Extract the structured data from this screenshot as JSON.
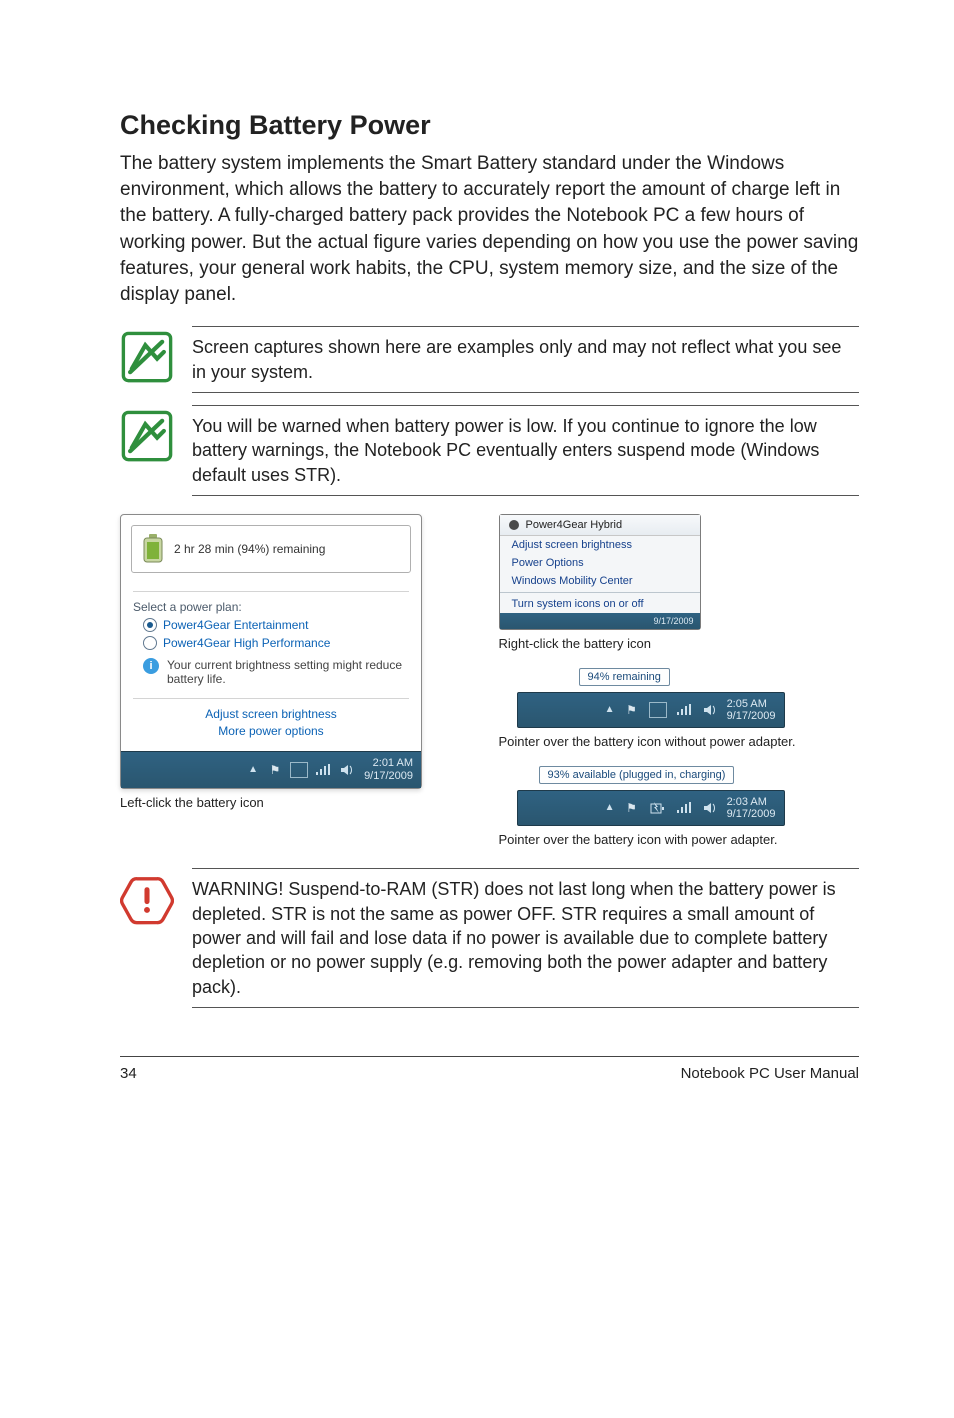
{
  "heading": "Checking Battery Power",
  "intro": "The battery system implements the Smart Battery standard under the Windows environment, which allows the battery to accurately report the amount of charge left in the battery. A fully-charged battery pack provides the Notebook PC a few hours of working power. But the actual figure varies depending on how you use the power saving features, your general work habits, the CPU, system memory size, and the size of the display panel.",
  "notes": {
    "note1": "Screen captures shown here are examples only and may not reflect what you see in your system.",
    "note2": "You will be warned when battery power is low. If you continue to ignore the low battery warnings, the Notebook PC eventually enters suspend mode (Windows default uses STR)."
  },
  "warning": "WARNING!  Suspend-to-RAM (STR) does not last long when the battery power is depleted. STR is not the same as power OFF. STR requires a small amount of power and will fail and lose data if no power is available due to complete battery depletion or no power supply (e.g. removing both the power adapter and battery pack).",
  "left_fig": {
    "top_status": "2 hr 28 min (94%) remaining",
    "plan_label": "Select a power plan:",
    "plan1": "Power4Gear Entertainment",
    "plan2": "Power4Gear High Performance",
    "info": "Your current brightness setting might reduce battery life.",
    "link1": "Adjust screen brightness",
    "link2": "More power options",
    "time": "2:01 AM",
    "date": "9/17/2009",
    "caption": "Left-click the battery icon"
  },
  "right_fig1": {
    "title": "Power4Gear Hybrid",
    "row1": "Adjust screen brightness",
    "row2": "Power Options",
    "row3": "Windows Mobility Center",
    "row4": "Turn system icons on or off",
    "date": "9/17/2009",
    "caption": "Right-click the battery icon"
  },
  "right_fig2": {
    "tooltip": "94% remaining",
    "time": "2:05 AM",
    "date": "9/17/2009",
    "caption": "Pointer over the battery icon without power adapter."
  },
  "right_fig3": {
    "tooltip": "93% available (plugged in, charging)",
    "time": "2:03 AM",
    "date": "9/17/2009",
    "caption": "Pointer over the battery icon with power adapter."
  },
  "footer": {
    "page": "34",
    "book": "Notebook PC User Manual"
  }
}
